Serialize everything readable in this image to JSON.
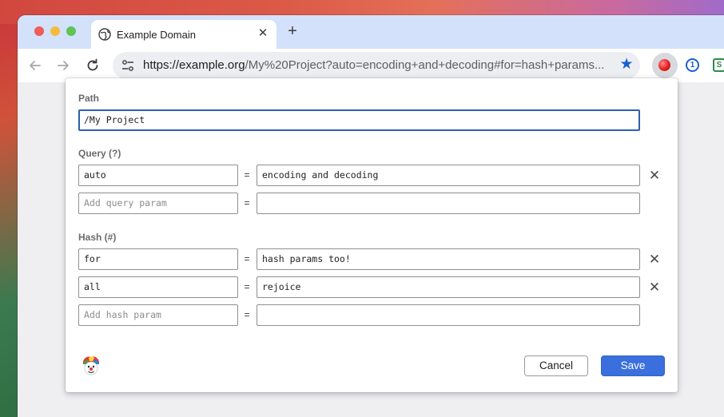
{
  "browser": {
    "tab_title": "Example Domain",
    "tab_close": "✕",
    "new_tab": "+",
    "url_host": "https://example.org",
    "url_rest": "/My%20Project?auto=encoding+and+decoding#for=hash+params...",
    "icons": [
      "back-arrow-icon",
      "forward-arrow-icon",
      "reload-icon",
      "site-info-icon",
      "bookmark-star-icon",
      "extension-icon",
      "onepassword-icon",
      "sheets-extension-icon"
    ]
  },
  "editor": {
    "path": {
      "label": "Path",
      "value": "/My Project"
    },
    "query": {
      "label": "Query (?)",
      "params": [
        {
          "key": "auto",
          "value": "encoding and decoding"
        }
      ],
      "add_placeholder": "Add query param"
    },
    "hash": {
      "label": "Hash (#)",
      "params": [
        {
          "key": "for",
          "value": "hash params too!"
        },
        {
          "key": "all",
          "value": "rejoice"
        }
      ],
      "add_placeholder": "Add hash param"
    },
    "equals": "=",
    "delete_glyph": "✕",
    "cancel_label": "Cancel",
    "save_label": "Save"
  },
  "colors": {
    "accent": "#3a6fdd",
    "tabstrip": "#d3e1fb",
    "focus_border": "#2c5fb0"
  }
}
